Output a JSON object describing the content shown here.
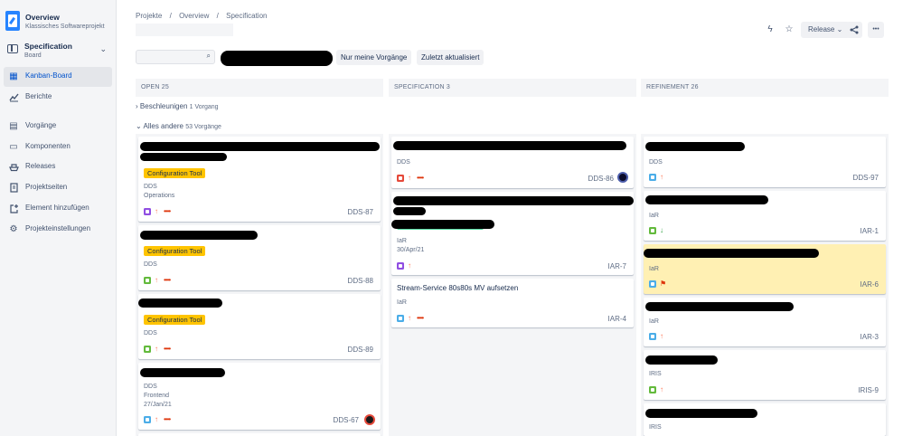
{
  "project": {
    "name": "Overview",
    "type": "Klassisches Softwareprojekt"
  },
  "board_selector": {
    "name": "Specification",
    "sub": "Board"
  },
  "nav": [
    {
      "label": "Kanban-Board",
      "icon": "board-icon",
      "glyph": "▦",
      "active": true
    },
    {
      "label": "Berichte",
      "icon": "chart-icon",
      "glyph": "📈"
    },
    {
      "label": "Vorgänge",
      "icon": "issues-icon",
      "glyph": "▤"
    },
    {
      "label": "Komponenten",
      "icon": "components-icon",
      "glyph": "▭"
    },
    {
      "label": "Releases",
      "icon": "releases-icon",
      "glyph": "⛴"
    },
    {
      "label": "Projektseiten",
      "icon": "page-icon",
      "glyph": "▯"
    },
    {
      "label": "Element hinzufügen",
      "icon": "add-item-icon",
      "glyph": "⊞"
    },
    {
      "label": "Projekteinstellungen",
      "icon": "settings-icon",
      "glyph": "⚙"
    }
  ],
  "breadcrumbs": [
    "Projekte",
    "/",
    "Overview",
    "/",
    "Specification"
  ],
  "toolbar": {
    "release_label": "Release",
    "chevron": "⌄",
    "lightning": "ϟ",
    "star": "☆",
    "share": "⤴",
    "more": "•••"
  },
  "search": {
    "icon": "⌕",
    "placeholder": ""
  },
  "filters": [
    "Nur meine Vorgänge",
    "Zuletzt aktualisiert"
  ],
  "columns": [
    {
      "label": "OPEN  25"
    },
    {
      "label": "SPECIFICATION  3"
    },
    {
      "label": "REFINEMENT  26"
    }
  ],
  "swimlanes": [
    {
      "label": "Beschleunigen",
      "count": "1 Vorgang",
      "chevron": "›"
    },
    {
      "label": "Alles andere",
      "count": "53 Vorgänge",
      "chevron": "⌄"
    }
  ],
  "cards": {
    "open": [
      {
        "epic": "Configuration Tool",
        "lines": [
          "DDS",
          "Operations"
        ],
        "key": "DDS-87"
      },
      {
        "epic": "Configuration Tool",
        "lines": [
          "DDS"
        ],
        "key": "DDS-88"
      },
      {
        "epic": "Configuration Tool",
        "lines": [
          "DDS"
        ],
        "key": "DDS-89"
      },
      {
        "lines": [
          "DDS",
          "Frontend",
          "27/Jan/21"
        ],
        "key": "DDS-67"
      }
    ],
    "spec": [
      {
        "lines": [
          "DDS"
        ],
        "key": "DDS-86"
      },
      {
        "lines": [
          "IaR",
          "30/Apr/21"
        ],
        "key": "IAR-7"
      },
      {
        "summary": "Stream-Service 80s80s MV aufsetzen",
        "lines": [
          "IaR"
        ],
        "key": "IAR-4"
      }
    ],
    "refine": [
      {
        "lines": [
          "DDS"
        ],
        "key": "DDS-97"
      },
      {
        "lines": [
          "IaR"
        ],
        "key": "IAR-1"
      },
      {
        "lines": [
          "IaR"
        ],
        "key": "IAR-6"
      },
      {
        "lines": [
          "IaR"
        ],
        "key": "IAR-3"
      },
      {
        "lines": [
          "IRIS"
        ],
        "key": "IRIS-9"
      },
      {
        "lines": [
          "IRIS"
        ],
        "key": ""
      }
    ]
  },
  "glyphs": {
    "priority_up": "↑",
    "priority_down": "↓",
    "flag": "⚑",
    "dots": "••••"
  },
  "colors": {
    "accent": "#0052cc",
    "epic_yellow": "#ffc400",
    "highlight": "#fff0b3",
    "priority": "#ff7452",
    "story": "#63ba3c",
    "task": "#4bade8",
    "subtask": "#904ee2",
    "bug": "#e5493a"
  }
}
